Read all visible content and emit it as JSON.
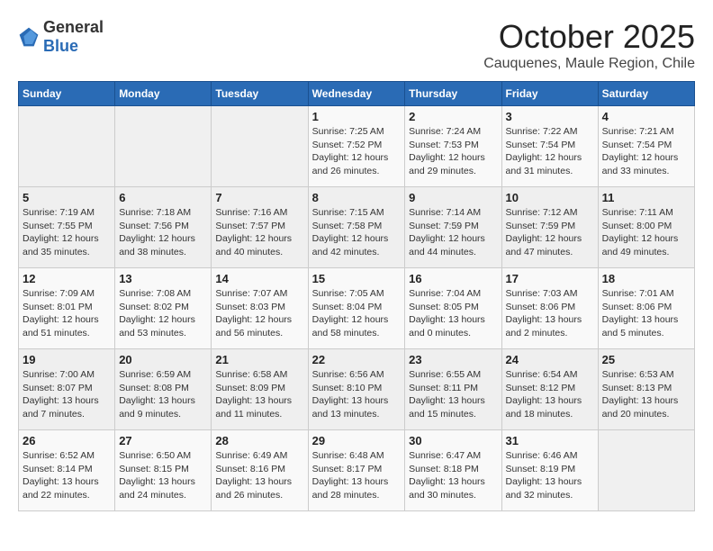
{
  "header": {
    "logo_general": "General",
    "logo_blue": "Blue",
    "month": "October 2025",
    "location": "Cauquenes, Maule Region, Chile"
  },
  "days_of_week": [
    "Sunday",
    "Monday",
    "Tuesday",
    "Wednesday",
    "Thursday",
    "Friday",
    "Saturday"
  ],
  "weeks": [
    [
      {
        "day": "",
        "info": ""
      },
      {
        "day": "",
        "info": ""
      },
      {
        "day": "",
        "info": ""
      },
      {
        "day": "1",
        "info": "Sunrise: 7:25 AM\nSunset: 7:52 PM\nDaylight: 12 hours\nand 26 minutes."
      },
      {
        "day": "2",
        "info": "Sunrise: 7:24 AM\nSunset: 7:53 PM\nDaylight: 12 hours\nand 29 minutes."
      },
      {
        "day": "3",
        "info": "Sunrise: 7:22 AM\nSunset: 7:54 PM\nDaylight: 12 hours\nand 31 minutes."
      },
      {
        "day": "4",
        "info": "Sunrise: 7:21 AM\nSunset: 7:54 PM\nDaylight: 12 hours\nand 33 minutes."
      }
    ],
    [
      {
        "day": "5",
        "info": "Sunrise: 7:19 AM\nSunset: 7:55 PM\nDaylight: 12 hours\nand 35 minutes."
      },
      {
        "day": "6",
        "info": "Sunrise: 7:18 AM\nSunset: 7:56 PM\nDaylight: 12 hours\nand 38 minutes."
      },
      {
        "day": "7",
        "info": "Sunrise: 7:16 AM\nSunset: 7:57 PM\nDaylight: 12 hours\nand 40 minutes."
      },
      {
        "day": "8",
        "info": "Sunrise: 7:15 AM\nSunset: 7:58 PM\nDaylight: 12 hours\nand 42 minutes."
      },
      {
        "day": "9",
        "info": "Sunrise: 7:14 AM\nSunset: 7:59 PM\nDaylight: 12 hours\nand 44 minutes."
      },
      {
        "day": "10",
        "info": "Sunrise: 7:12 AM\nSunset: 7:59 PM\nDaylight: 12 hours\nand 47 minutes."
      },
      {
        "day": "11",
        "info": "Sunrise: 7:11 AM\nSunset: 8:00 PM\nDaylight: 12 hours\nand 49 minutes."
      }
    ],
    [
      {
        "day": "12",
        "info": "Sunrise: 7:09 AM\nSunset: 8:01 PM\nDaylight: 12 hours\nand 51 minutes."
      },
      {
        "day": "13",
        "info": "Sunrise: 7:08 AM\nSunset: 8:02 PM\nDaylight: 12 hours\nand 53 minutes."
      },
      {
        "day": "14",
        "info": "Sunrise: 7:07 AM\nSunset: 8:03 PM\nDaylight: 12 hours\nand 56 minutes."
      },
      {
        "day": "15",
        "info": "Sunrise: 7:05 AM\nSunset: 8:04 PM\nDaylight: 12 hours\nand 58 minutes."
      },
      {
        "day": "16",
        "info": "Sunrise: 7:04 AM\nSunset: 8:05 PM\nDaylight: 13 hours\nand 0 minutes."
      },
      {
        "day": "17",
        "info": "Sunrise: 7:03 AM\nSunset: 8:06 PM\nDaylight: 13 hours\nand 2 minutes."
      },
      {
        "day": "18",
        "info": "Sunrise: 7:01 AM\nSunset: 8:06 PM\nDaylight: 13 hours\nand 5 minutes."
      }
    ],
    [
      {
        "day": "19",
        "info": "Sunrise: 7:00 AM\nSunset: 8:07 PM\nDaylight: 13 hours\nand 7 minutes."
      },
      {
        "day": "20",
        "info": "Sunrise: 6:59 AM\nSunset: 8:08 PM\nDaylight: 13 hours\nand 9 minutes."
      },
      {
        "day": "21",
        "info": "Sunrise: 6:58 AM\nSunset: 8:09 PM\nDaylight: 13 hours\nand 11 minutes."
      },
      {
        "day": "22",
        "info": "Sunrise: 6:56 AM\nSunset: 8:10 PM\nDaylight: 13 hours\nand 13 minutes."
      },
      {
        "day": "23",
        "info": "Sunrise: 6:55 AM\nSunset: 8:11 PM\nDaylight: 13 hours\nand 15 minutes."
      },
      {
        "day": "24",
        "info": "Sunrise: 6:54 AM\nSunset: 8:12 PM\nDaylight: 13 hours\nand 18 minutes."
      },
      {
        "day": "25",
        "info": "Sunrise: 6:53 AM\nSunset: 8:13 PM\nDaylight: 13 hours\nand 20 minutes."
      }
    ],
    [
      {
        "day": "26",
        "info": "Sunrise: 6:52 AM\nSunset: 8:14 PM\nDaylight: 13 hours\nand 22 minutes."
      },
      {
        "day": "27",
        "info": "Sunrise: 6:50 AM\nSunset: 8:15 PM\nDaylight: 13 hours\nand 24 minutes."
      },
      {
        "day": "28",
        "info": "Sunrise: 6:49 AM\nSunset: 8:16 PM\nDaylight: 13 hours\nand 26 minutes."
      },
      {
        "day": "29",
        "info": "Sunrise: 6:48 AM\nSunset: 8:17 PM\nDaylight: 13 hours\nand 28 minutes."
      },
      {
        "day": "30",
        "info": "Sunrise: 6:47 AM\nSunset: 8:18 PM\nDaylight: 13 hours\nand 30 minutes."
      },
      {
        "day": "31",
        "info": "Sunrise: 6:46 AM\nSunset: 8:19 PM\nDaylight: 13 hours\nand 32 minutes."
      },
      {
        "day": "",
        "info": ""
      }
    ]
  ]
}
